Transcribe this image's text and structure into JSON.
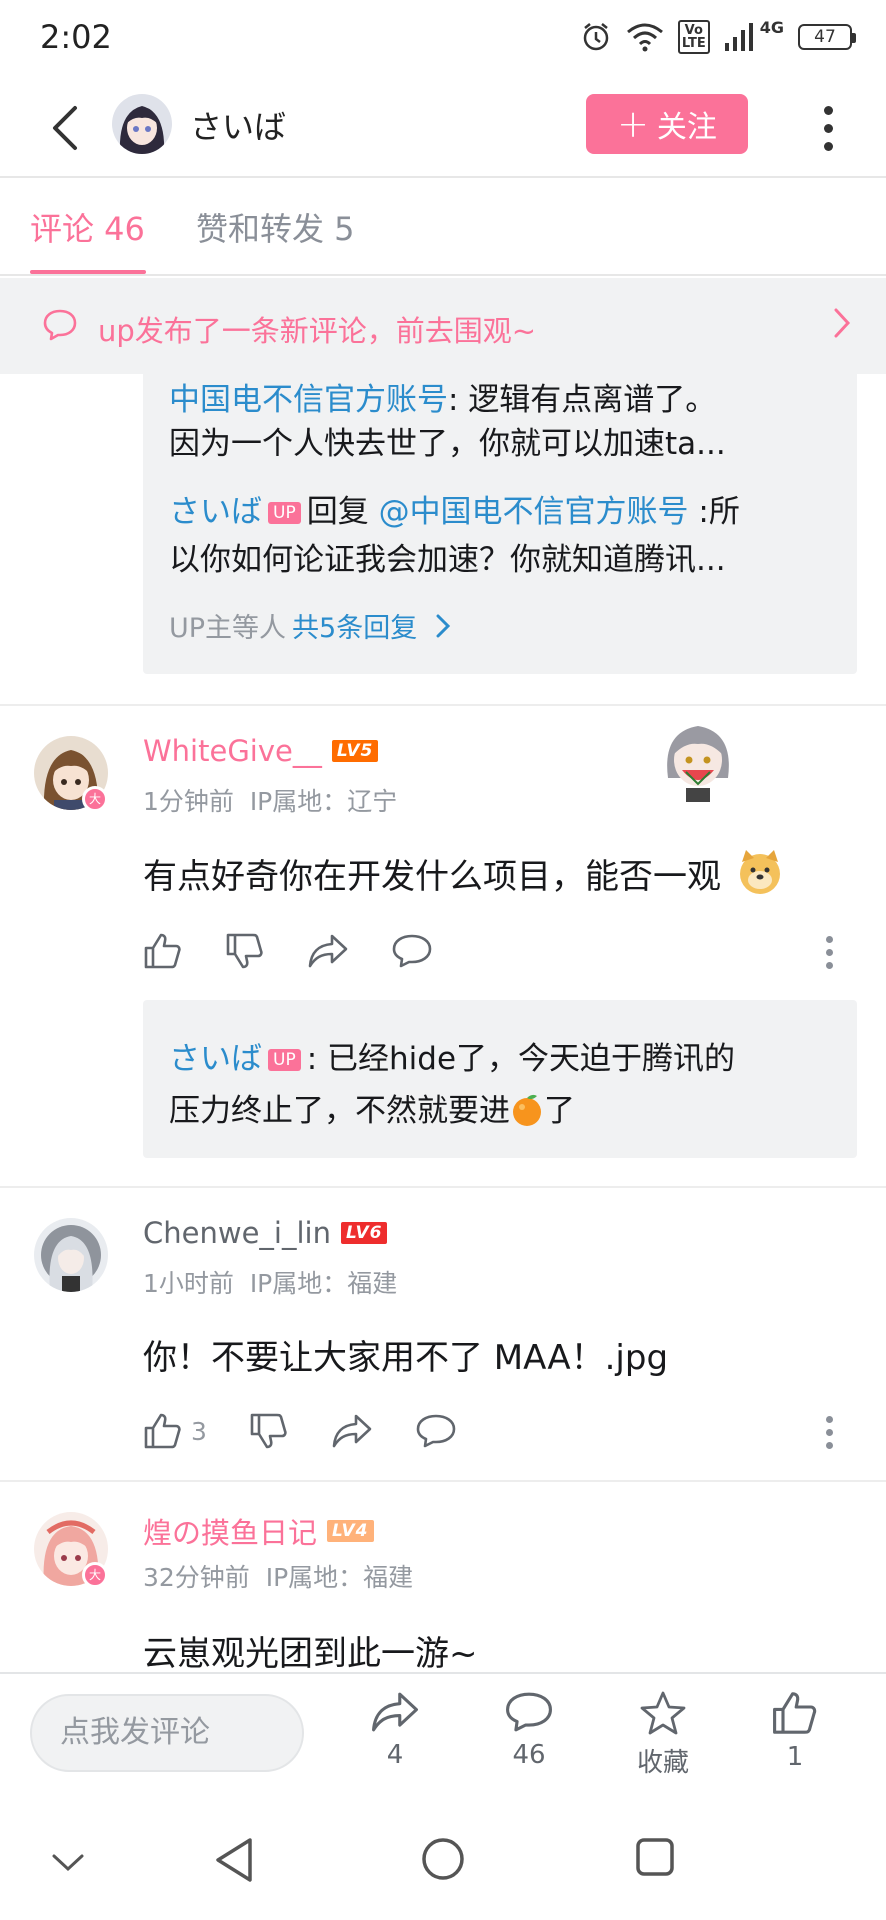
{
  "status_bar": {
    "time": "2:02",
    "network_label": "4G",
    "volte_label": "Vo LTE",
    "battery": "47"
  },
  "header": {
    "username": "さいば",
    "follow_label": "关注"
  },
  "tabs": [
    {
      "label": "评论 46",
      "active": true
    },
    {
      "label": "赞和转发 5",
      "active": false
    }
  ],
  "notice": {
    "text": "up发布了一条新评论，前去围观~"
  },
  "reply_box_1": {
    "line1_user": "中国电不信官方账号",
    "line1_text": ": 逻辑有点离谱了。",
    "line2_text": "因为一个人快去世了，你就可以加速ta...",
    "line3_user": "さいば",
    "up_tag": "UP",
    "line3_reply": "回复",
    "line3_mention": "@中国电不信官方账号",
    "line3_text": " :所",
    "line4_text": "以你如何论证我会加速？你就知道腾讯...",
    "more_prefix": "UP主等人",
    "more_count": "共5条回复"
  },
  "comments": [
    {
      "username": "WhiteGive__",
      "level": "LV5",
      "level_color": "#ff6c00",
      "badge": "大",
      "time": "1分钟前",
      "ip": "IP属地：辽宁",
      "text": "有点好奇你在开发什么项目，能否一观",
      "emoji": "doge-emoji",
      "like_count": "",
      "reply": {
        "user": "さいば",
        "up_tag": "UP",
        "text1": ": 已经hide了，今天迫于腾讯的",
        "text2": "压力终止了，不然就要进",
        "text3": "了",
        "emoji": "orange-emoji"
      }
    },
    {
      "username": "Chenwe_i_lin",
      "level": "LV6",
      "level_color": "#ee2d2d",
      "time": "1小时前",
      "ip": "IP属地：福建",
      "text": "你！不要让大家用不了 MAA！.jpg",
      "like_count": "3"
    },
    {
      "username": "煌の摸鱼日记",
      "level": "LV4",
      "level_color": "#ffb27a",
      "badge": "大",
      "time": "32分钟前",
      "ip": "IP属地：福建",
      "text": "云崽观光团到此一游~"
    }
  ],
  "bottom_bar": {
    "input_placeholder": "点我发评论",
    "share_count": "4",
    "comment_count": "46",
    "favorite_label": "收藏",
    "like_count": "1"
  },
  "colors": {
    "accent": "#fb7299",
    "link": "#2b8ccc"
  }
}
